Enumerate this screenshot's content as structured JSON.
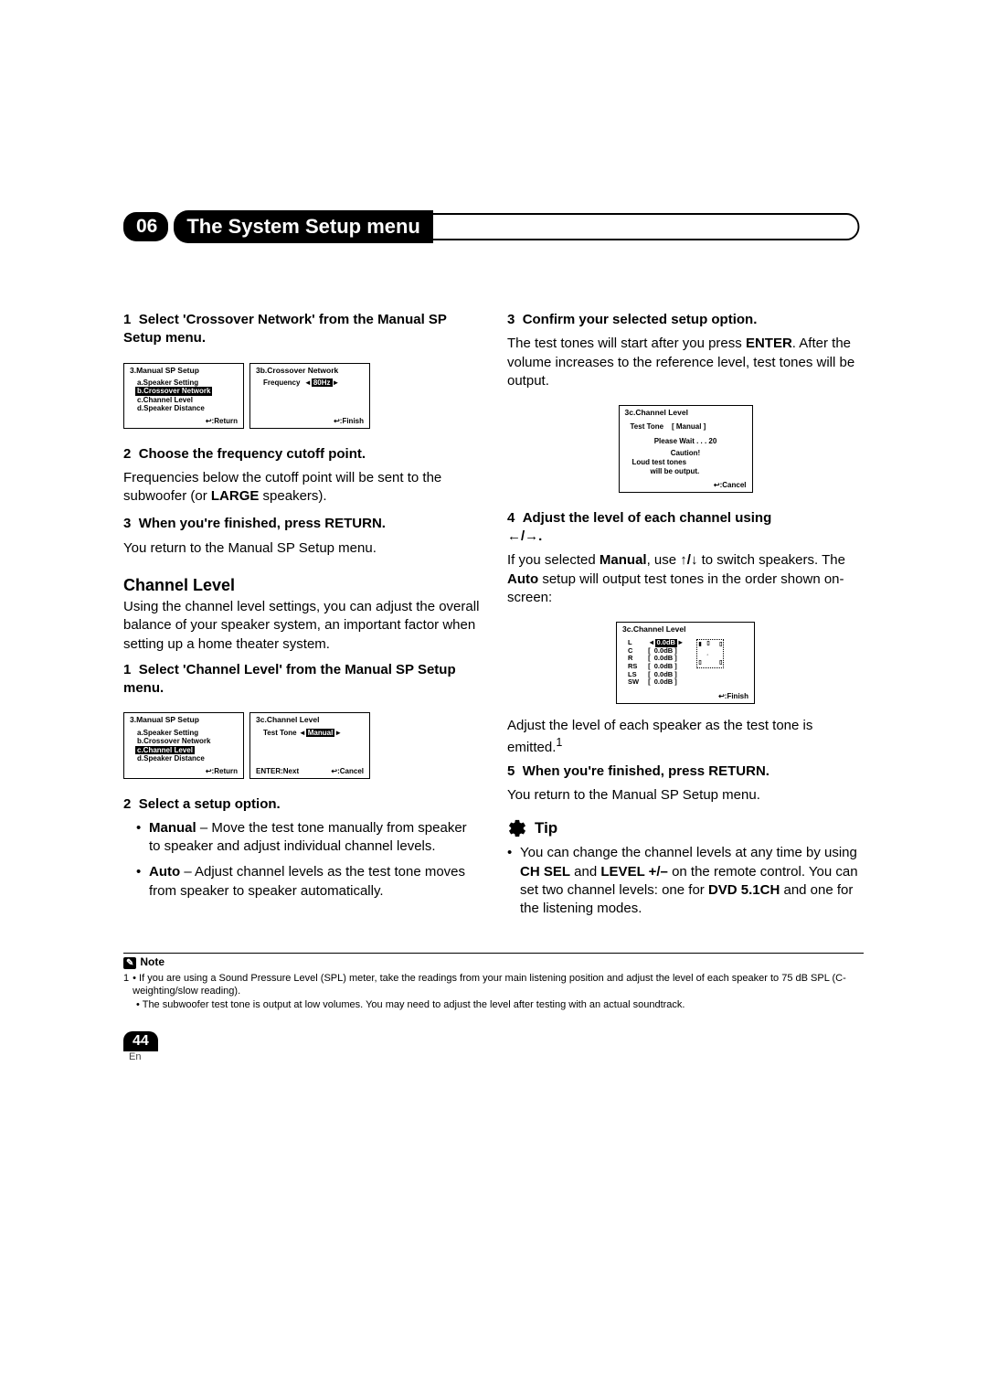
{
  "chapter": {
    "number": "06",
    "title": "The System Setup menu"
  },
  "left": {
    "step1": {
      "num": "1",
      "title": "Select 'Crossover Network' from the Manual SP Setup menu."
    },
    "osd_a": {
      "title": "3.Manual  SP  Setup",
      "items": [
        "a.Speaker  Setting",
        "b.Crossover  Network",
        "c.Channel  Level",
        "d.Speaker  Distance"
      ],
      "highlight_index": 1,
      "footer_icon": "↩",
      "footer_label": ":Return"
    },
    "osd_b": {
      "title": "3b.Crossover  Network",
      "row_label": "Frequency",
      "row_value": "80Hz",
      "footer_icon": "↩",
      "footer_label": ":Finish"
    },
    "step2": {
      "num": "2",
      "title": "Choose the frequency cutoff point.",
      "body1": "Frequencies below the cutoff point will be sent to the subwoofer (or ",
      "body_bold": "LARGE",
      "body2": " speakers)."
    },
    "step3": {
      "num": "3",
      "title": "When you're finished, press RETURN.",
      "body": "You return to the Manual SP Setup menu."
    },
    "section": "Channel Level",
    "section_body": "Using the channel level settings, you can adjust the overall balance of your speaker system, an important factor when setting up a home theater system.",
    "cl_step1": {
      "num": "1",
      "title": "Select 'Channel Level' from the Manual SP Setup menu."
    },
    "osd_c": {
      "title": "3.Manual  SP  Setup",
      "items": [
        "a.Speaker  Setting",
        "b.Crossover  Network",
        "c.Channel  Level",
        "d.Speaker  Distance"
      ],
      "highlight_index": 2,
      "footer_icon": "↩",
      "footer_label": ":Return"
    },
    "osd_d": {
      "title": "3c.Channel  Level",
      "row_label": "Test  Tone",
      "row_value": "Manual",
      "footer_left": "ENTER:Next",
      "footer_icon": "↩",
      "footer_label": ":Cancel"
    },
    "cl_step2": {
      "num": "2",
      "title": "Select a setup option."
    },
    "cl_manual": {
      "name": "Manual",
      "body": " – Move the test tone manually from speaker to speaker and adjust individual channel levels."
    },
    "cl_auto": {
      "name": "Auto",
      "body": " – Adjust channel levels as the test tone moves from speaker to speaker automatically."
    }
  },
  "right": {
    "step3": {
      "num": "3",
      "title": "Confirm your selected setup option.",
      "body1": "The test tones will start after you press ",
      "body_bold": "ENTER",
      "body2": ". After the volume increases to the reference level, test tones will be output."
    },
    "osd_e": {
      "title": "3c.Channel  Level",
      "line1a": "Test  Tone",
      "line1b": "[  Manual  ]",
      "line2": "Please  Wait . . . 20",
      "line3": "Caution!",
      "line4": "Loud  test  tones",
      "line5": "will  be  output.",
      "footer_icon": "↩",
      "footer_label": ":Cancel"
    },
    "step4": {
      "num": "4",
      "title_a": "Adjust the level of each channel using ",
      "title_b": "←/→.",
      "body1a": "If you selected ",
      "body1b": "Manual",
      "body1c": ", use ",
      "body1d": "↑/↓",
      "body1e": " to switch speakers. The ",
      "body1f": "Auto",
      "body1g": " setup will output test tones in the order shown on-screen:"
    },
    "osd_f": {
      "title": "3c.Channel  Level",
      "channels": [
        "L",
        "C",
        "R",
        "RS",
        "LS",
        "SW"
      ],
      "values": [
        "0.0dB",
        "0.0dB",
        "0.0dB",
        "0.0dB",
        "0.0dB",
        "0.0dB"
      ],
      "highlight_index": 0,
      "footer_icon": "↩",
      "footer_label": ":Finish"
    },
    "after_osd_f": "Adjust the level of each speaker as the test tone is emitted.",
    "sup": "1",
    "step5": {
      "num": "5",
      "title": "When you're finished, press RETURN.",
      "body": "You return to the Manual SP Setup menu."
    },
    "tip": {
      "label": "Tip",
      "body1": "You can change the channel levels at any time by using ",
      "b1": "CH SEL",
      "mid": " and ",
      "b2": "LEVEL +/–",
      "body2": " on the remote control. You can set two channel levels: one for ",
      "b3": "DVD 5.1CH",
      "body3": " and one for the listening modes."
    }
  },
  "note": {
    "label": "Note",
    "n1_num": "1",
    "n1": "If you are using a Sound Pressure Level (SPL) meter, take the readings from your main listening position and adjust the level of each speaker to 75 dB SPL (C-weighting/slow reading).",
    "n2": "The subwoofer test tone is output at low volumes. You may need to adjust the level after testing with an actual soundtrack."
  },
  "page_number": "44",
  "lang": "En"
}
